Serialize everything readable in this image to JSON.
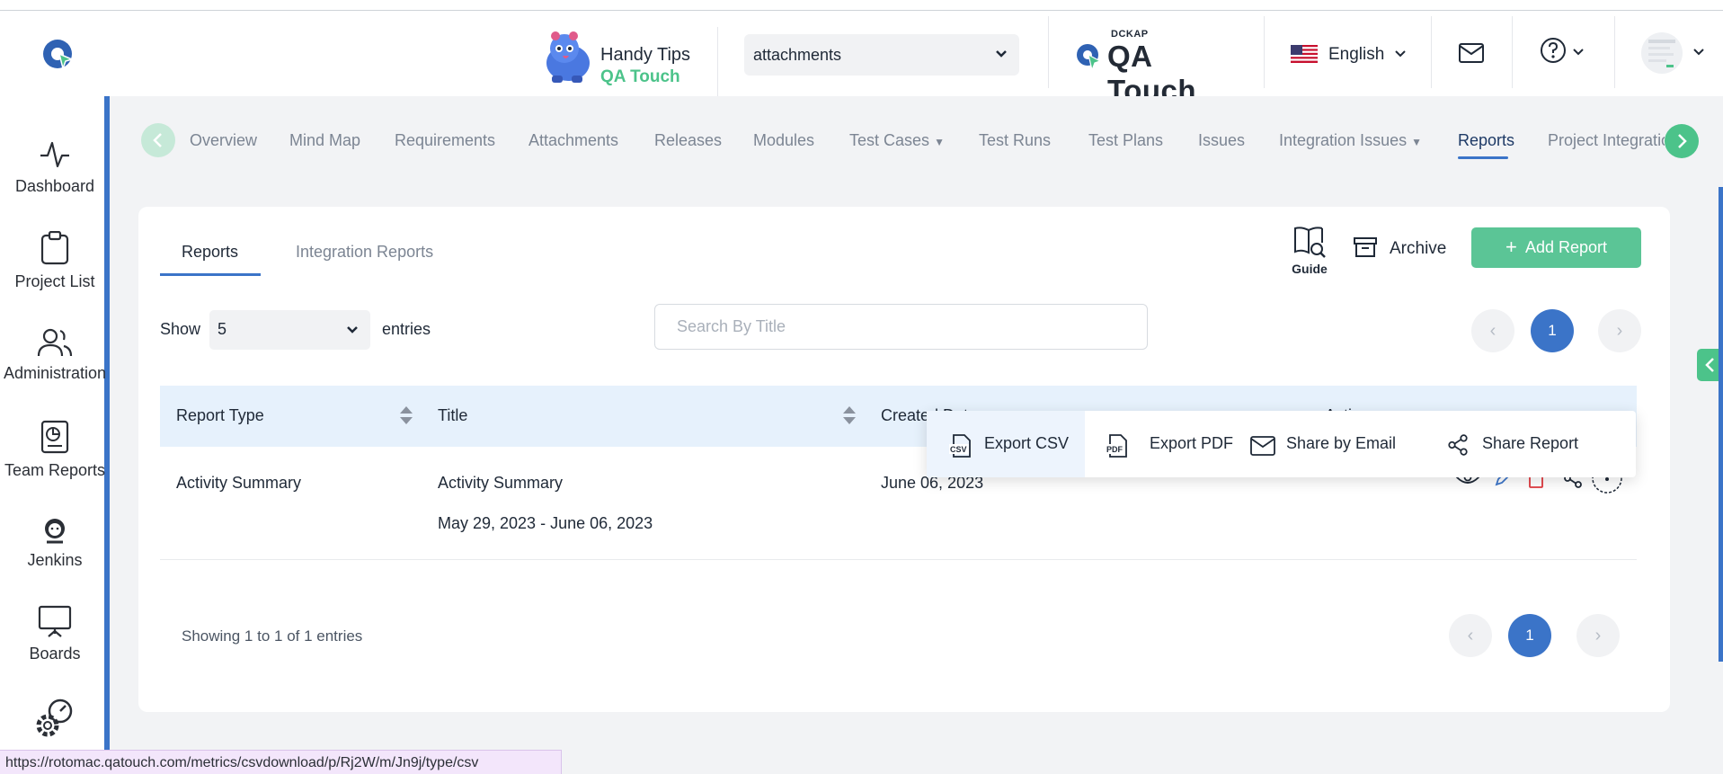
{
  "header": {
    "handy_tips_line1": "Handy Tips",
    "handy_tips_line2": "QA Touch",
    "project_select": "attachments",
    "brand_small": "DCKAP",
    "brand_large": "QA Touch",
    "language": "English"
  },
  "sidebar": {
    "items": [
      {
        "label": "Dashboard",
        "icon": "activity-icon"
      },
      {
        "label": "Project List",
        "icon": "clipboard-icon"
      },
      {
        "label": "Administration",
        "icon": "users-icon"
      },
      {
        "label": "Team Reports",
        "icon": "report-icon"
      },
      {
        "label": "Jenkins",
        "icon": "jenkins-icon"
      },
      {
        "label": "Boards",
        "icon": "presentation-icon"
      },
      {
        "label": "",
        "icon": "settings-gear-icon"
      }
    ]
  },
  "nav": {
    "tabs": [
      "Overview",
      "Mind Map",
      "Requirements",
      "Attachments",
      "Releases",
      "Modules",
      "Test Cases",
      "Test Runs",
      "Test Plans",
      "Issues",
      "Integration Issues",
      "Reports",
      "Project Integratio"
    ],
    "active": "Reports"
  },
  "page": {
    "tabs": {
      "reports": "Reports",
      "integration": "Integration Reports"
    },
    "guide_label": "Guide",
    "archive_label": "Archive",
    "add_report_plus": "+",
    "add_report_label": "Add Report",
    "show_label": "Show",
    "show_value": "5",
    "entries_label": "entries",
    "search_placeholder": "Search By Title",
    "page_number": "1",
    "prev_symbol": "‹",
    "next_symbol": "›"
  },
  "table": {
    "headers": {
      "type": "Report Type",
      "title": "Title",
      "created": "Created Date",
      "action": "Action"
    },
    "rows": [
      {
        "type": "Activity Summary",
        "title": "Activity Summary",
        "range": "May 29, 2023 - June 06, 2023",
        "created": "June 06, 2023"
      }
    ]
  },
  "popup": {
    "export_csv": "Export CSV",
    "export_pdf": "Export PDF",
    "share_email": "Share by Email",
    "share_report": "Share Report",
    "csv_icon_text": "CSV",
    "pdf_icon_text": "PDF"
  },
  "footer": {
    "showing": "Showing 1 to 1 of 1 entries"
  },
  "status_url": "https://rotomac.qatouch.com/metrics/csvdownload/p/Rj2W/m/Jn9j/type/csv",
  "colors": {
    "accent_blue": "#3b74c8",
    "accent_green": "#5bc596",
    "header_row": "#e6f1fc"
  }
}
